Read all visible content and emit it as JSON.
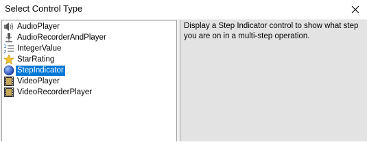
{
  "window": {
    "title": "Select Control Type",
    "close_label": "✕"
  },
  "controls": [
    {
      "label": "AudioPlayer",
      "icon": "speaker-icon",
      "selected": false
    },
    {
      "label": "AudioRecorderAndPlayer",
      "icon": "microphone-icon",
      "selected": false
    },
    {
      "label": "IntegerValue",
      "icon": "numbered-list-icon",
      "selected": false
    },
    {
      "label": "StarRating",
      "icon": "star-icon",
      "selected": false
    },
    {
      "label": "StepIndicator",
      "icon": "step-indicator-icon",
      "selected": true
    },
    {
      "label": "VideoPlayer",
      "icon": "film-icon",
      "selected": false
    },
    {
      "label": "VideoRecorderPlayer",
      "icon": "film-icon",
      "selected": false
    }
  ],
  "description": "Display a Step Indicator control to show what step you are on in a multi-step operation.",
  "colors": {
    "selection": "#0078d7",
    "description_background": "#e3e3e3"
  }
}
